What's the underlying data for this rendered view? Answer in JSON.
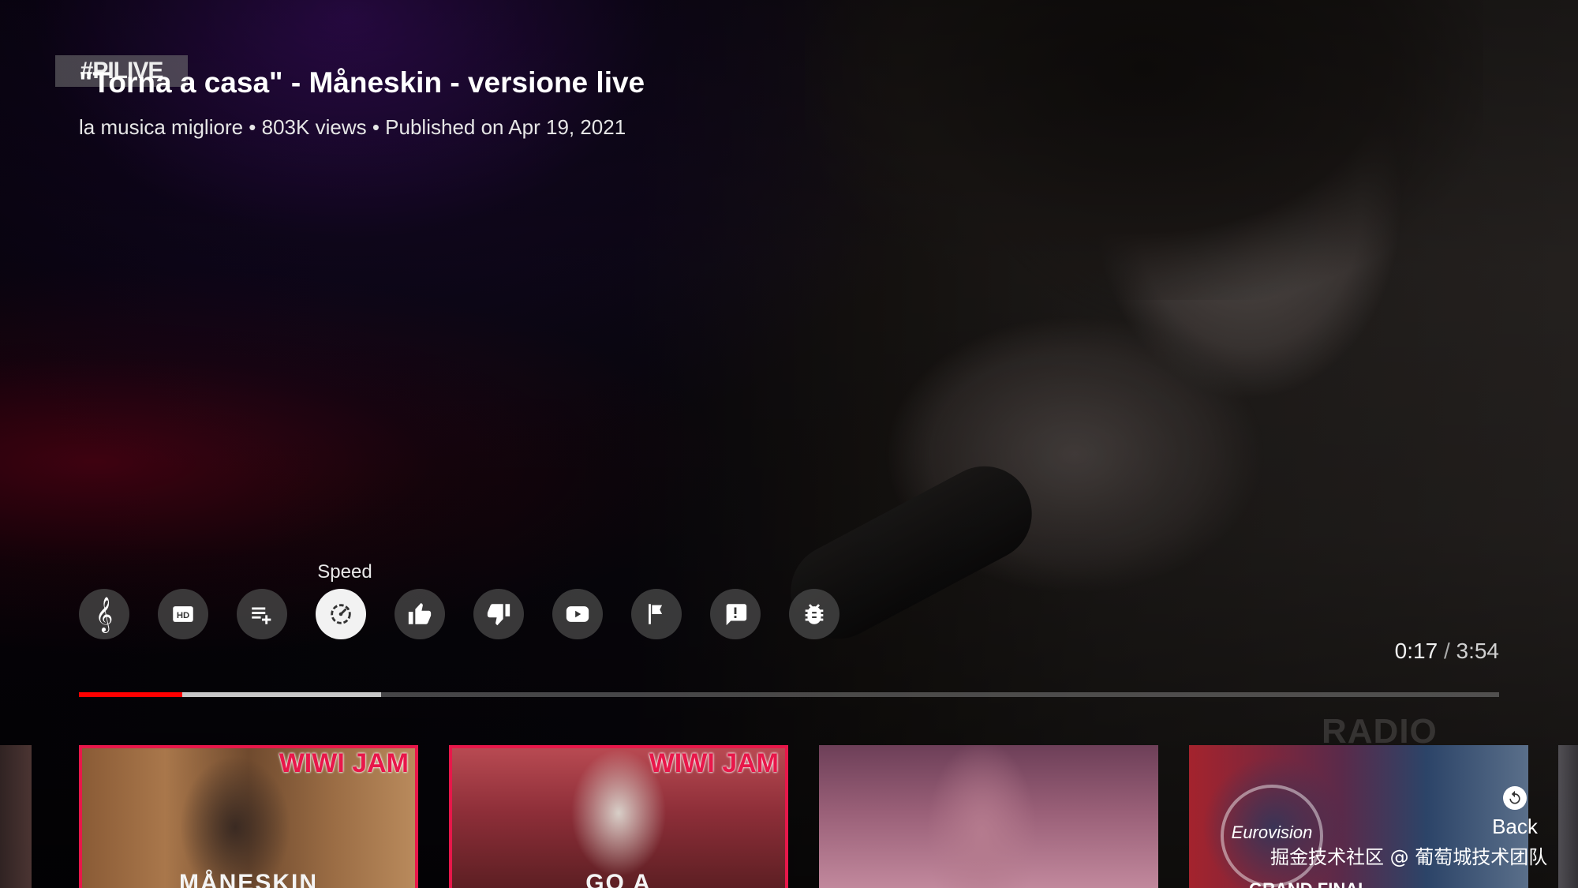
{
  "video": {
    "channel_badge": "#PILIVE",
    "title": "\"Torna a casa\" - Måneskin - versione live",
    "channel": "la musica migliore",
    "views": "803K views",
    "published": "Published on Apr 19, 2021",
    "separator": " • "
  },
  "controls": {
    "focused_label": "Speed",
    "buttons": [
      {
        "name": "audio-track",
        "icon": "treble-clef-icon"
      },
      {
        "name": "quality",
        "icon": "hd-icon"
      },
      {
        "name": "add-to-playlist",
        "icon": "playlist-add-icon"
      },
      {
        "name": "speed",
        "icon": "speed-icon",
        "focused": true
      },
      {
        "name": "like",
        "icon": "thumbs-up-icon"
      },
      {
        "name": "dislike",
        "icon": "thumbs-down-icon"
      },
      {
        "name": "channel",
        "icon": "youtube-play-icon"
      },
      {
        "name": "report",
        "icon": "flag-icon"
      },
      {
        "name": "feedback",
        "icon": "feedback-icon"
      },
      {
        "name": "debug",
        "icon": "bug-icon"
      }
    ]
  },
  "playback": {
    "current_time": "0:17",
    "time_separator": "/",
    "duration": "3:54",
    "played_fraction": 0.073,
    "buffered_fraction": 0.213,
    "accent_color": "#ff0000"
  },
  "suggestions": {
    "cards": [
      {
        "logo": "WIWI JAM",
        "caption": "MÅNESKIN"
      },
      {
        "logo": "WIWI JAM",
        "caption": "GO A"
      },
      {
        "logo": "",
        "caption": ""
      },
      {
        "logo": "Eurovision",
        "caption": "GRAND FINAL"
      }
    ],
    "radio_logo": "RADIO"
  },
  "back": {
    "label": "Back",
    "icon": "back-arrow-icon"
  },
  "watermark": "掘金技术社区 @ 葡萄城技术团队"
}
